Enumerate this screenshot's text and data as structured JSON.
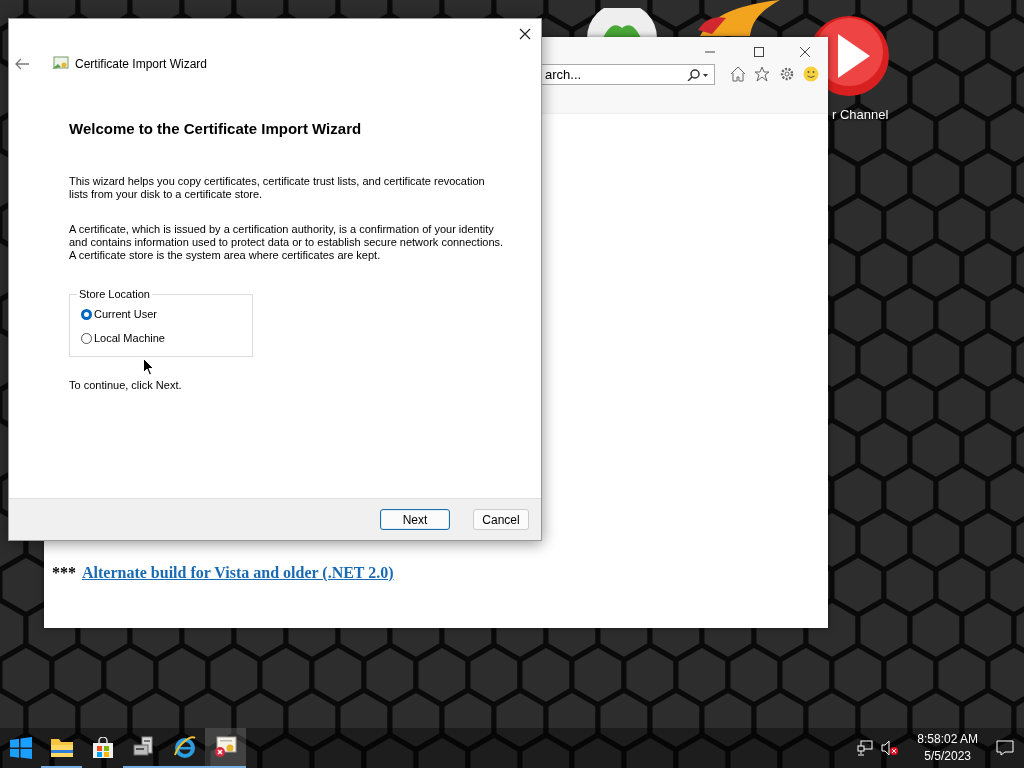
{
  "desktop": {
    "icon_label": "r Channel"
  },
  "browser": {
    "search": {
      "placeholder": "arch..."
    },
    "content": {
      "prefix": "***",
      "link": "Alternate build for Vista and older (.NET 2.0)"
    }
  },
  "dialog": {
    "title": "Certificate Import Wizard",
    "heading": "Welcome to the Certificate Import Wizard",
    "paragraphs": [
      "This wizard helps you copy certificates, certificate trust lists, and certificate revocation lists from your disk to a certificate store.",
      "A certificate, which is issued by a certification authority, is a confirmation of your identity and contains information used to protect data or to establish secure network connections. A certificate store is the system area where certificates are kept."
    ],
    "store_location": {
      "label": "Store Location",
      "options": [
        {
          "label": "Current User",
          "selected": true
        },
        {
          "label": "Local Machine",
          "selected": false
        }
      ]
    },
    "hint": "To continue, click Next.",
    "buttons": [
      {
        "label": "Next",
        "default": true
      },
      {
        "label": "Cancel",
        "default": false
      }
    ]
  },
  "taskbar": {
    "apps": [
      {
        "kind": "explorer",
        "running": true,
        "selected": false
      },
      {
        "kind": "store",
        "running": false,
        "selected": false
      },
      {
        "kind": "device",
        "running": true,
        "selected": false
      },
      {
        "kind": "ie",
        "running": true,
        "selected": false
      },
      {
        "kind": "certificate",
        "running": true,
        "selected": true
      }
    ],
    "clock": {
      "time": "8:58:02 AM",
      "date": "5/5/2023"
    }
  }
}
